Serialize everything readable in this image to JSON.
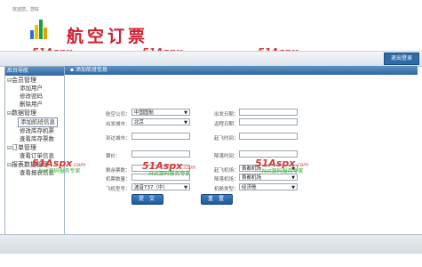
{
  "header": {
    "title": "航空订票",
    "brand_colors": [
      "#f2c200",
      "#1e9e3a",
      "#2d6fd1",
      "#e0a000"
    ]
  },
  "watermark": {
    "main": "51Aspx",
    "domain": ".com",
    "sub": ".Net源码服务专家"
  },
  "topbar": {
    "welcome": "欢迎您，您好",
    "logout_label": "退出登录"
  },
  "sidebar": {
    "title": "后台导航",
    "groups": [
      {
        "sign": "⊟",
        "label": "会员管理",
        "items": [
          "添加用户",
          "修改密码",
          "删除用户"
        ]
      },
      {
        "sign": "⊟",
        "label": "数据管理",
        "items": [
          "添加航班信息",
          "修改库存机票",
          "查看库存票数"
        ]
      },
      {
        "sign": "⊟",
        "label": "订单管理",
        "items": [
          "查看订单信息"
        ]
      },
      {
        "sign": "⊟",
        "label": "报表数据管理",
        "items": [
          "查看报表信息"
        ]
      }
    ],
    "active_item": "添加航班信息"
  },
  "main": {
    "title": "添加航班信息",
    "form": {
      "airline_label": "航空公司：",
      "airline_value": "中国国航",
      "depart_date_label": "出发日期：",
      "depart_city_label": "出发城市：",
      "depart_city_value": "北京",
      "return_date_label": "返程日期：",
      "arrive_city_label": "到达城市：",
      "takeoff_time_label": "起飞时间：",
      "ticket_price_label": "票价：",
      "landing_time_label": "降落时间：",
      "remaining_label": "剩余票数：",
      "takeoff_airport_label": "起飞机场：",
      "takeoff_airport_value": "首都机场",
      "plane_count_label": "机票数量：",
      "landing_airport_label": "降落机场：",
      "landing_airport_value": "首都机场",
      "plane_model_label": "飞机型号：",
      "plane_model_value": "波音737（中）",
      "cabin_label": "机舱类型：",
      "cabin_value": "经济舱",
      "submit_label": "提 交",
      "reset_label": "重 置"
    }
  }
}
